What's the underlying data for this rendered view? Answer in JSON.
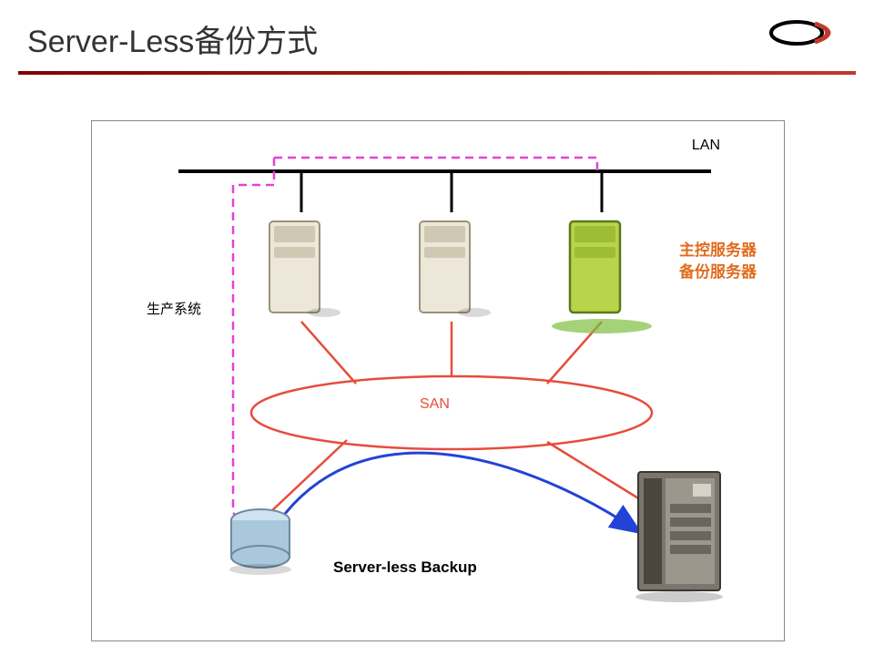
{
  "title": "Server-Less备份方式",
  "lan_label": "LAN",
  "prod_label": "生产系统",
  "control_label_1": "主控服务器",
  "control_label_2": "备份服务器",
  "san_label": "SAN",
  "serverless_label": "Server-less Backup",
  "nodes": {
    "server1": "production-server-1",
    "server2": "production-server-2",
    "server3": "backup-control-server",
    "disk": "storage-disk",
    "tape": "tape-library"
  }
}
